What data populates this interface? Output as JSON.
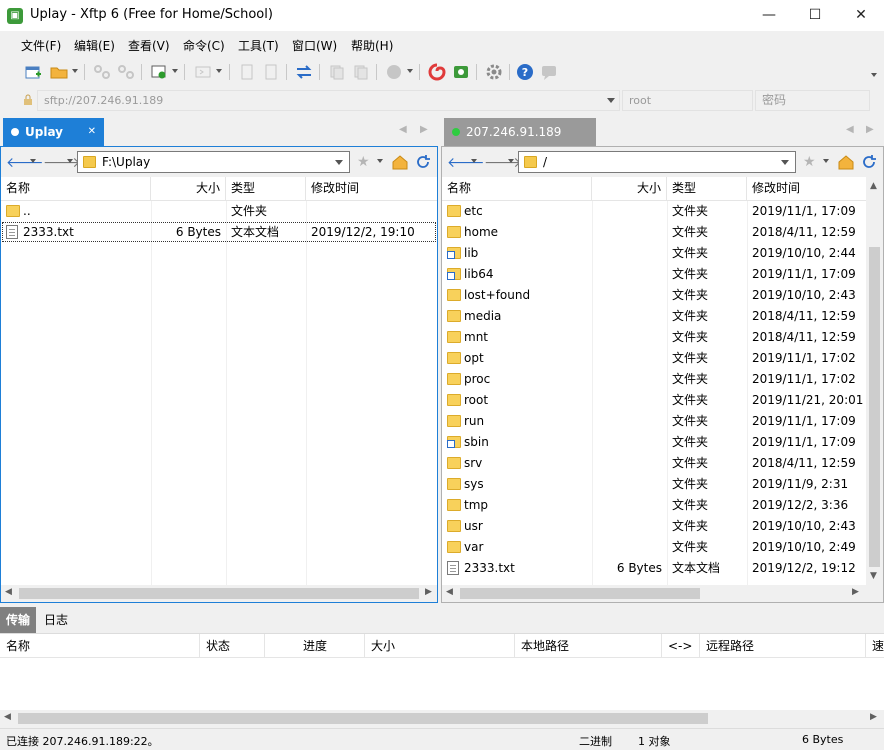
{
  "window": {
    "title": "Uplay - Xftp 6 (Free for Home/School)",
    "minimize": "—",
    "maximize": "☐",
    "close": "✕"
  },
  "menu": [
    "文件(F)",
    "编辑(E)",
    "查看(V)",
    "命令(C)",
    "工具(T)",
    "窗口(W)",
    "帮助(H)"
  ],
  "address": {
    "host_placeholder": "sftp://207.246.91.189",
    "user_placeholder": "root",
    "password_placeholder": "密码"
  },
  "left_pane": {
    "tab_label": "Uplay",
    "path": "F:\\Uplay",
    "columns": [
      "名称",
      "大小",
      "类型",
      "修改时间"
    ],
    "files": [
      {
        "name": "..",
        "size": "",
        "type": "文件夹",
        "modified": "",
        "icon": "folder"
      },
      {
        "name": "2333.txt",
        "size": "6 Bytes",
        "type": "文本文档",
        "modified": "2019/12/2, 19:10",
        "icon": "file"
      }
    ]
  },
  "right_pane": {
    "tab_label": "207.246.91.189",
    "path": "/",
    "columns": [
      "名称",
      "大小",
      "类型",
      "修改时间"
    ],
    "files": [
      {
        "name": "etc",
        "size": "",
        "type": "文件夹",
        "modified": "2019/11/1, 17:09",
        "icon": "folder"
      },
      {
        "name": "home",
        "size": "",
        "type": "文件夹",
        "modified": "2018/4/11, 12:59",
        "icon": "folder"
      },
      {
        "name": "lib",
        "size": "",
        "type": "文件夹",
        "modified": "2019/10/10, 2:44",
        "icon": "folder-link"
      },
      {
        "name": "lib64",
        "size": "",
        "type": "文件夹",
        "modified": "2019/11/1, 17:09",
        "icon": "folder-link"
      },
      {
        "name": "lost+found",
        "size": "",
        "type": "文件夹",
        "modified": "2019/10/10, 2:43",
        "icon": "folder"
      },
      {
        "name": "media",
        "size": "",
        "type": "文件夹",
        "modified": "2018/4/11, 12:59",
        "icon": "folder"
      },
      {
        "name": "mnt",
        "size": "",
        "type": "文件夹",
        "modified": "2018/4/11, 12:59",
        "icon": "folder"
      },
      {
        "name": "opt",
        "size": "",
        "type": "文件夹",
        "modified": "2019/11/1, 17:02",
        "icon": "folder"
      },
      {
        "name": "proc",
        "size": "",
        "type": "文件夹",
        "modified": "2019/11/1, 17:02",
        "icon": "folder"
      },
      {
        "name": "root",
        "size": "",
        "type": "文件夹",
        "modified": "2019/11/21, 20:01",
        "icon": "folder"
      },
      {
        "name": "run",
        "size": "",
        "type": "文件夹",
        "modified": "2019/11/1, 17:09",
        "icon": "folder"
      },
      {
        "name": "sbin",
        "size": "",
        "type": "文件夹",
        "modified": "2019/11/1, 17:09",
        "icon": "folder-link"
      },
      {
        "name": "srv",
        "size": "",
        "type": "文件夹",
        "modified": "2018/4/11, 12:59",
        "icon": "folder"
      },
      {
        "name": "sys",
        "size": "",
        "type": "文件夹",
        "modified": "2019/11/9, 2:31",
        "icon": "folder"
      },
      {
        "name": "tmp",
        "size": "",
        "type": "文件夹",
        "modified": "2019/12/2, 3:36",
        "icon": "folder"
      },
      {
        "name": "usr",
        "size": "",
        "type": "文件夹",
        "modified": "2019/10/10, 2:43",
        "icon": "folder"
      },
      {
        "name": "var",
        "size": "",
        "type": "文件夹",
        "modified": "2019/10/10, 2:49",
        "icon": "folder"
      },
      {
        "name": "2333.txt",
        "size": "6 Bytes",
        "type": "文本文档",
        "modified": "2019/12/2, 19:12",
        "icon": "file"
      }
    ]
  },
  "bottom_tabs": [
    "传输",
    "日志"
  ],
  "transfer_columns": [
    "名称",
    "状态",
    "进度",
    "大小",
    "本地路径",
    "<->",
    "远程路径",
    "速"
  ],
  "status": {
    "connection": "已连接 207.246.91.189:22。",
    "mode": "二进制",
    "selection": "1 对象",
    "size": "6 Bytes"
  },
  "colors": {
    "accent": "#1e7fd7",
    "folder": "#f8d15b",
    "inactive_tab": "#9a9a9a",
    "left_status_dot": "#ffffff",
    "right_status_dot": "#2ecc40"
  }
}
